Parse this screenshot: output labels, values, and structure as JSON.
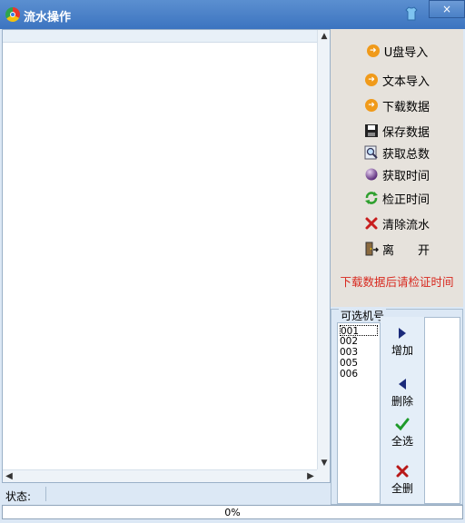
{
  "window": {
    "title": "流水操作",
    "close": "×"
  },
  "log": {
    "v_up": "▲",
    "v_down": "▼",
    "h_left": "◀",
    "h_right": "▶"
  },
  "status": {
    "label": "状态:"
  },
  "progress": {
    "value": 0,
    "text": "0%"
  },
  "actions": [
    {
      "label": "U盘导入",
      "icon": "orange-arrow-icon"
    },
    {
      "label": "文本导入",
      "icon": "orange-arrow-icon"
    },
    {
      "label": "下载数据",
      "icon": "orange-arrow-icon"
    },
    {
      "label": "保存数据",
      "icon": "floppy-disk-icon"
    },
    {
      "label": "获取总数",
      "icon": "magnifier-icon"
    },
    {
      "label": "获取时间",
      "icon": "purple-ball-icon"
    },
    {
      "label": "检正时间",
      "icon": "refresh-icon"
    },
    {
      "label": "清除流水",
      "icon": "red-x-icon"
    },
    {
      "label": "离　　开",
      "icon": "exit-door-icon"
    }
  ],
  "notice": "下载数据后请检证时间",
  "machines": {
    "group_title": "可选机号",
    "items": [
      "001",
      "002",
      "003",
      "005",
      "006"
    ],
    "buttons": [
      {
        "label": "增加",
        "icon": "triangle-right-icon"
      },
      {
        "label": "删除",
        "icon": "triangle-left-icon"
      },
      {
        "label": "全选",
        "icon": "green-check-icon"
      },
      {
        "label": "全删",
        "icon": "red-x-icon"
      }
    ]
  },
  "colors": {
    "title_bar": "#4a80c6",
    "notice": "#d8281e",
    "progress": "#3c9bdb"
  }
}
